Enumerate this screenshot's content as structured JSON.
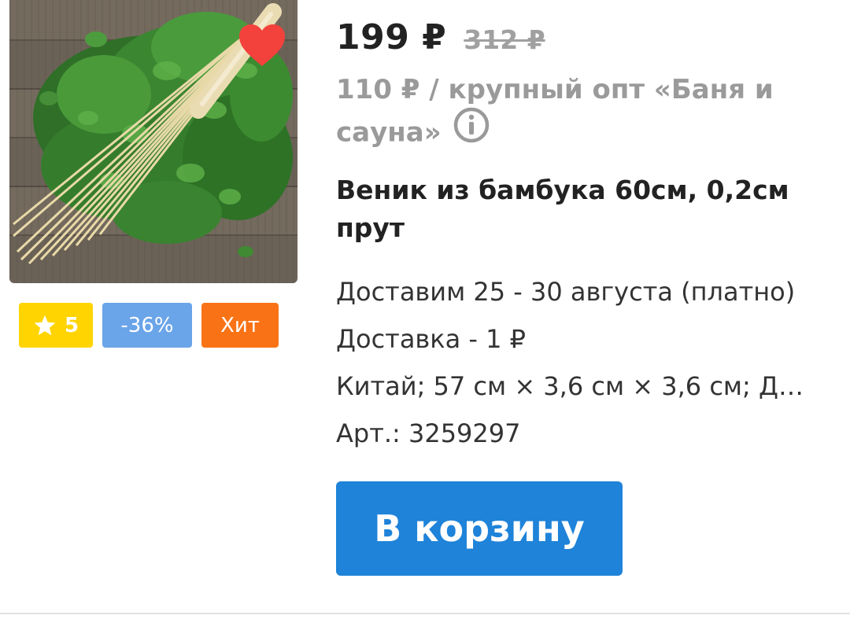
{
  "product": {
    "image_alt": "Веник из бамбука",
    "favorite_icon": "heart-icon",
    "favorite_color": "#f3413c"
  },
  "badges": {
    "rating": {
      "icon": "star-icon",
      "value": "5",
      "color": "#ffd400"
    },
    "discount": {
      "label": "-36%",
      "color": "#6aa4e9"
    },
    "hit": {
      "label": "Хит",
      "color": "#f97316"
    }
  },
  "pricing": {
    "price": "199 ₽",
    "old_price": "312 ₽",
    "wholesale": "110 ₽ / крупный опт «Баня и сауна»",
    "info_icon": "info-icon"
  },
  "title": "Веник из бамбука 60см, 0,2см прут",
  "details": {
    "delivery_date": "Доставим 25 - 30 августа (платно)",
    "delivery_cost": "Доставка - 1 ₽",
    "specs": "Китай; 57 см × 3,6 см × 3,6 см; Де...",
    "article": "Арт.: 3259297"
  },
  "actions": {
    "cart_label": "В корзину",
    "cart_color": "#1e83d9"
  }
}
